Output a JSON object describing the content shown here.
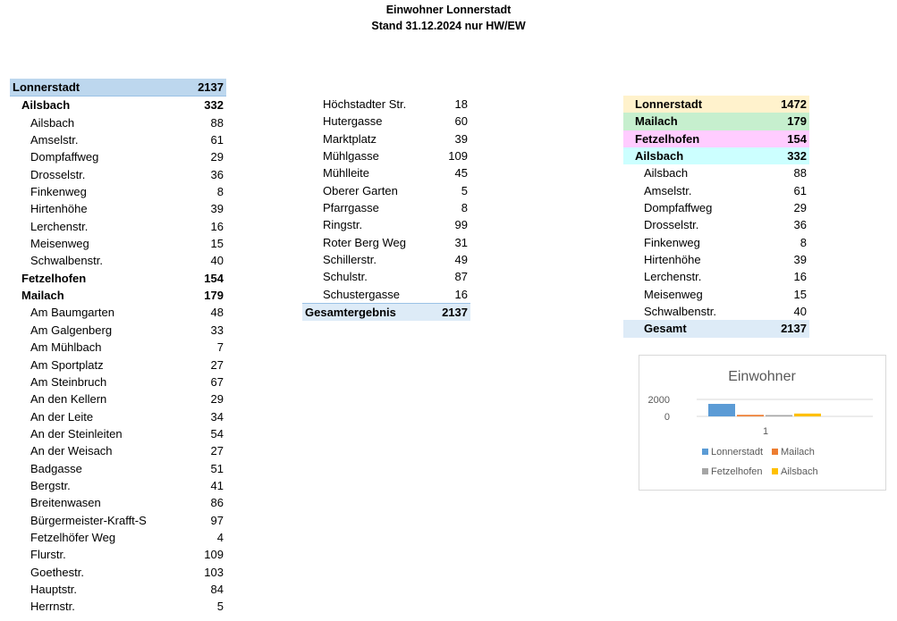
{
  "header": {
    "title": "Einwohner Lonnerstadt",
    "subtitle": "Stand 31.12.2024 nur HW/EW"
  },
  "left_table": {
    "rows": [
      {
        "label": "Lonnerstadt",
        "value": "2137",
        "level": 0,
        "bold": true,
        "highlight": "#bdd7ee"
      },
      {
        "label": "Ailsbach",
        "value": "332",
        "level": 1,
        "bold": true
      },
      {
        "label": "Ailsbach",
        "value": "88",
        "level": 2
      },
      {
        "label": "Amselstr.",
        "value": "61",
        "level": 2
      },
      {
        "label": "Dompfaffweg",
        "value": "29",
        "level": 2
      },
      {
        "label": "Drosselstr.",
        "value": "36",
        "level": 2
      },
      {
        "label": "Finkenweg",
        "value": "8",
        "level": 2
      },
      {
        "label": "Hirtenhöhe",
        "value": "39",
        "level": 2
      },
      {
        "label": "Lerchenstr.",
        "value": "16",
        "level": 2
      },
      {
        "label": "Meisenweg",
        "value": "15",
        "level": 2
      },
      {
        "label": "Schwalbenstr.",
        "value": "40",
        "level": 2
      },
      {
        "label": "Fetzelhofen",
        "value": "154",
        "level": 1,
        "bold": true
      },
      {
        "label": "Mailach",
        "value": "179",
        "level": 1,
        "bold": true
      },
      {
        "label": "Am Baumgarten",
        "value": "48",
        "level": 2
      },
      {
        "label": "Am Galgenberg",
        "value": "33",
        "level": 2
      },
      {
        "label": "Am Mühlbach",
        "value": "7",
        "level": 2
      },
      {
        "label": "Am Sportplatz",
        "value": "27",
        "level": 2
      },
      {
        "label": "Am Steinbruch",
        "value": "67",
        "level": 2
      },
      {
        "label": "An den Kellern",
        "value": "29",
        "level": 2
      },
      {
        "label": "An der Leite",
        "value": "34",
        "level": 2
      },
      {
        "label": "An der Steinleiten",
        "value": "54",
        "level": 2
      },
      {
        "label": "An der Weisach",
        "value": "27",
        "level": 2
      },
      {
        "label": "Badgasse",
        "value": "51",
        "level": 2
      },
      {
        "label": "Bergstr.",
        "value": "41",
        "level": 2
      },
      {
        "label": "Breitenwasen",
        "value": "86",
        "level": 2
      },
      {
        "label": "Bürgermeister-Krafft-S",
        "value": "97",
        "level": 2
      },
      {
        "label": "Fetzelhöfer Weg",
        "value": "4",
        "level": 2
      },
      {
        "label": "Flurstr.",
        "value": "109",
        "level": 2
      },
      {
        "label": "Goethestr.",
        "value": "103",
        "level": 2
      },
      {
        "label": "Hauptstr.",
        "value": "84",
        "level": 2
      },
      {
        "label": "Herrnstr.",
        "value": "5",
        "level": 2
      }
    ]
  },
  "middle_table": {
    "rows": [
      {
        "label": "Höchstadter Str.",
        "value": "18"
      },
      {
        "label": "Hutergasse",
        "value": "60"
      },
      {
        "label": "Marktplatz",
        "value": "39"
      },
      {
        "label": "Mühlgasse",
        "value": "109"
      },
      {
        "label": "Mühlleite",
        "value": "45"
      },
      {
        "label": "Oberer Garten",
        "value": "5"
      },
      {
        "label": "Pfarrgasse",
        "value": "8"
      },
      {
        "label": "Ringstr.",
        "value": "99"
      },
      {
        "label": "Roter Berg Weg",
        "value": "31"
      },
      {
        "label": "Schillerstr.",
        "value": "49"
      },
      {
        "label": "Schulstr.",
        "value": "87"
      },
      {
        "label": "Schustergasse",
        "value": "16"
      }
    ],
    "total": {
      "label": "Gesamtergebnis",
      "value": "2137"
    }
  },
  "right_table": {
    "rows": [
      {
        "label": "Lonnerstadt",
        "value": "1472",
        "bold": true,
        "highlight": "#fff2cc"
      },
      {
        "label": "Mailach",
        "value": "179",
        "bold": true,
        "highlight": "#c6efce"
      },
      {
        "label": "Fetzelhofen",
        "value": "154",
        "bold": true,
        "highlight": "#ffccff"
      },
      {
        "label": "Ailsbach",
        "value": "332",
        "bold": true,
        "highlight": "#ccffff"
      },
      {
        "label": "Ailsbach",
        "value": "88",
        "sub": true
      },
      {
        "label": "Amselstr.",
        "value": "61",
        "sub": true
      },
      {
        "label": "Dompfaffweg",
        "value": "29",
        "sub": true
      },
      {
        "label": "Drosselstr.",
        "value": "36",
        "sub": true
      },
      {
        "label": "Finkenweg",
        "value": "8",
        "sub": true
      },
      {
        "label": "Hirtenhöhe",
        "value": "39",
        "sub": true
      },
      {
        "label": "Lerchenstr.",
        "value": "16",
        "sub": true
      },
      {
        "label": "Meisenweg",
        "value": "15",
        "sub": true
      },
      {
        "label": "Schwalbenstr.",
        "value": "40",
        "sub": true
      }
    ],
    "total": {
      "label": "Gesamt",
      "value": "2137"
    }
  },
  "chart_data": {
    "type": "bar",
    "title": "Einwohner",
    "categories": [
      "1"
    ],
    "series": [
      {
        "name": "Lonnerstadt",
        "values": [
          1472
        ],
        "color": "#5b9bd5"
      },
      {
        "name": "Mailach",
        "values": [
          179
        ],
        "color": "#ed7d31"
      },
      {
        "name": "Fetzelhofen",
        "values": [
          154
        ],
        "color": "#a5a5a5"
      },
      {
        "name": "Ailsbach",
        "values": [
          332
        ],
        "color": "#ffc000"
      }
    ],
    "ylim": [
      0,
      2000
    ],
    "yticks": [
      "2000",
      "0"
    ],
    "grid": true,
    "legend": "bottom"
  }
}
